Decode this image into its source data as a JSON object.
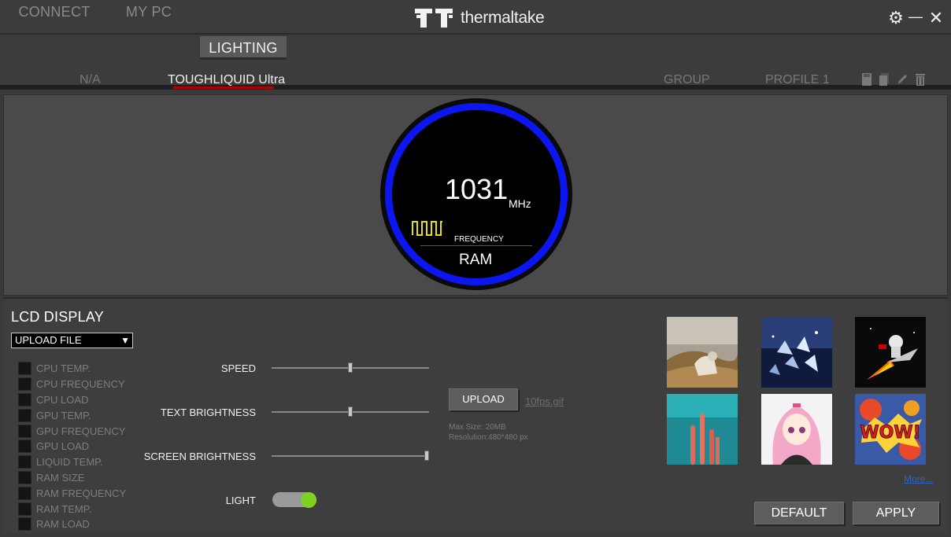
{
  "app": {
    "brand": "thermaltake"
  },
  "window_controls": [
    {
      "name": "gear-icon",
      "symbol": "⚙"
    },
    {
      "name": "minimize-icon",
      "symbol": "—"
    },
    {
      "name": "close-icon",
      "symbol": "✕"
    }
  ],
  "nav": {
    "tabs": [
      "CONNECT",
      "MY PC",
      "LIGHTING"
    ],
    "active": "LIGHTING"
  },
  "subnav": {
    "items": [
      "N/A",
      "TOUGHLIQUID Ultra",
      "GROUP",
      "PROFILE 1"
    ],
    "active": "TOUGHLIQUID Ultra",
    "accent_color": "#b00000",
    "tool_icons": [
      "save-icon",
      "copy-icon",
      "edit-icon",
      "delete-icon"
    ]
  },
  "preview": {
    "value": "1031",
    "unit": "MHz",
    "metric_label": "FREQUENCY",
    "device": "RAM",
    "ring_color": "#0b16f0",
    "wave_color": "#e8e000"
  },
  "lcd": {
    "title": "LCD DISPLAY",
    "mode": "UPLOAD FILE",
    "mode_arrow": "▼",
    "sensors": [
      "CPU TEMP.",
      "CPU FREQUENCY",
      "CPU LOAD",
      "GPU TEMP.",
      "GPU FREQUENCY",
      "GPU LOAD",
      "LIQUID TEMP.",
      "RAM SIZE",
      "RAM FREQUENCY",
      "RAM TEMP.",
      "RAM LOAD"
    ],
    "sliders": [
      {
        "label": "SPEED",
        "value": 0.5
      },
      {
        "label": "TEXT BRIGHTNESS",
        "value": 0.5
      },
      {
        "label": "SCREEN BRIGHTNESS",
        "value": 1.0
      }
    ],
    "light": {
      "label": "LIGHT",
      "on": true,
      "color": "#7ed321"
    },
    "upload": {
      "button": "UPLOAD",
      "filename": "10fps.gif",
      "max_size": "Max Size: 20MB",
      "resolution": "Resolution:480*480 px"
    },
    "gallery": [
      "desert-dog-image",
      "ice-crystals-image",
      "astronaut-rocket-image",
      "coral-image",
      "anime-girl-image",
      "wow-comic-image"
    ],
    "more": "More..."
  },
  "actions": {
    "default": "DEFAULT",
    "apply": "APPLY"
  }
}
